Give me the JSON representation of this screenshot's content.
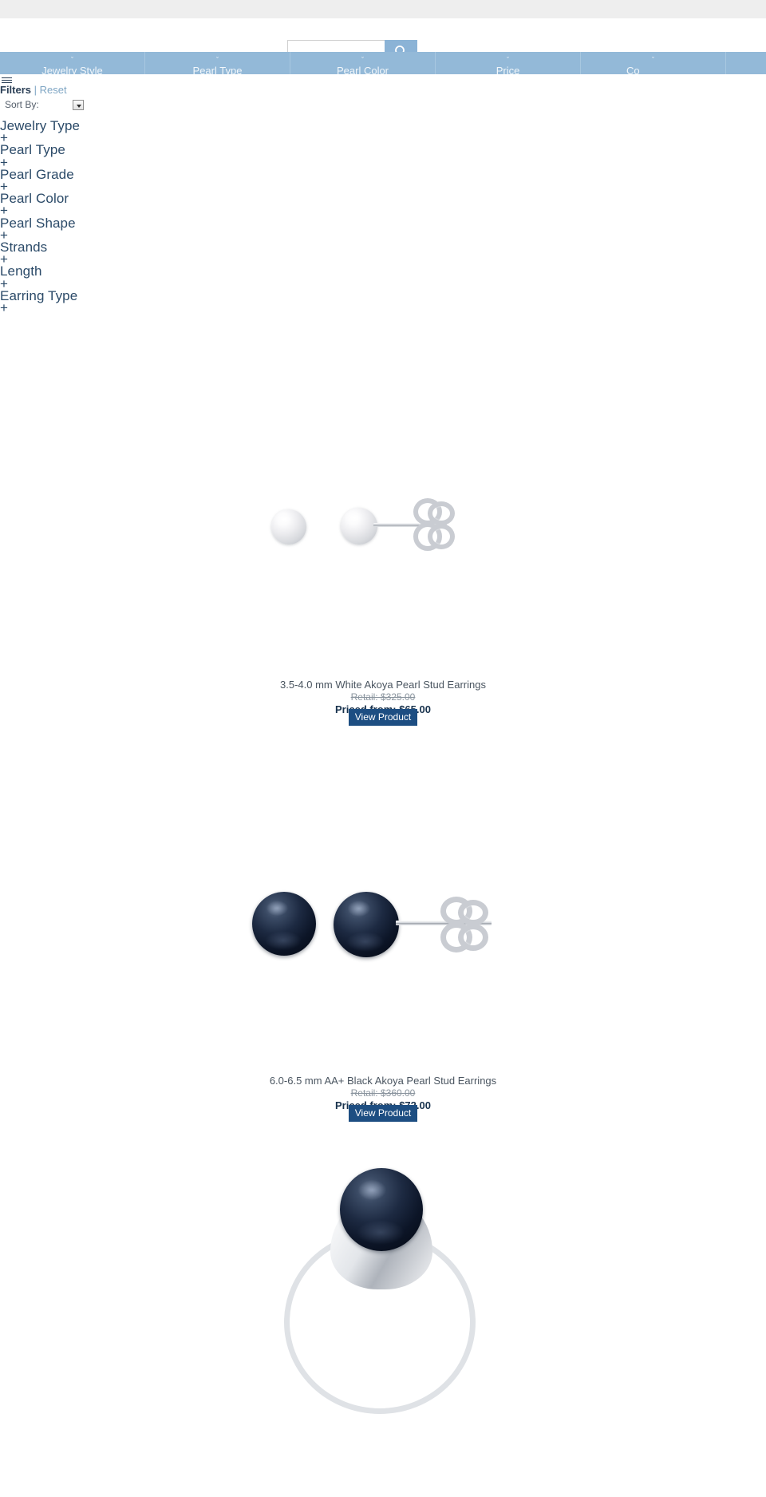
{
  "search": {
    "value": "",
    "placeholder": "",
    "button_icon": "search-icon"
  },
  "nav": {
    "items": [
      {
        "label": "Jewelry Style",
        "caret": "ˇ"
      },
      {
        "label": "Pearl Type",
        "caret": "ˇ"
      },
      {
        "label": "Pearl Color",
        "caret": "ˇ"
      },
      {
        "label": "Price",
        "caret": "ˇ"
      },
      {
        "label": "Co",
        "caret": "ˇ"
      }
    ]
  },
  "sidebar": {
    "menu_icon": "hamburger-icon",
    "filters_label": "Filters",
    "separator": "|",
    "reset_label": "Reset",
    "sort_label": "Sort By:",
    "sort_value": "",
    "facets": [
      {
        "name": "Jewelry Type",
        "toggle": "+"
      },
      {
        "name": "Pearl Type",
        "toggle": "+"
      },
      {
        "name": "Pearl Grade",
        "toggle": "+"
      },
      {
        "name": "Pearl Color",
        "toggle": "+"
      },
      {
        "name": "Pearl Shape",
        "toggle": "+"
      },
      {
        "name": "Strands",
        "toggle": "+"
      },
      {
        "name": "Length",
        "toggle": "+"
      },
      {
        "name": "Earring Type",
        "toggle": "+"
      }
    ]
  },
  "products": [
    {
      "title": "3.5-4.0 mm White Akoya Pearl Stud Earrings",
      "retail": "Retail: $325.00",
      "price": "Priced from: $65.00",
      "cta": "View Product",
      "image": "white-akoya-pearl-stud-earrings"
    },
    {
      "title": "6.0-6.5 mm AA+ Black Akoya Pearl Stud Earrings",
      "retail": "Retail: $360.00",
      "price": "Priced from: $72.00",
      "cta": "View Product",
      "image": "black-akoya-pearl-stud-earrings"
    },
    {
      "title": "",
      "retail": "",
      "price": "",
      "cta": "",
      "image": "black-pearl-solitaire-ring"
    }
  ],
  "colors": {
    "nav_blue": "#93b9d8",
    "search_btn": "#8bb3d6",
    "cta_blue": "#1d4e82",
    "facet_text": "#2b4a68",
    "top_strip": "#eeeeee"
  }
}
